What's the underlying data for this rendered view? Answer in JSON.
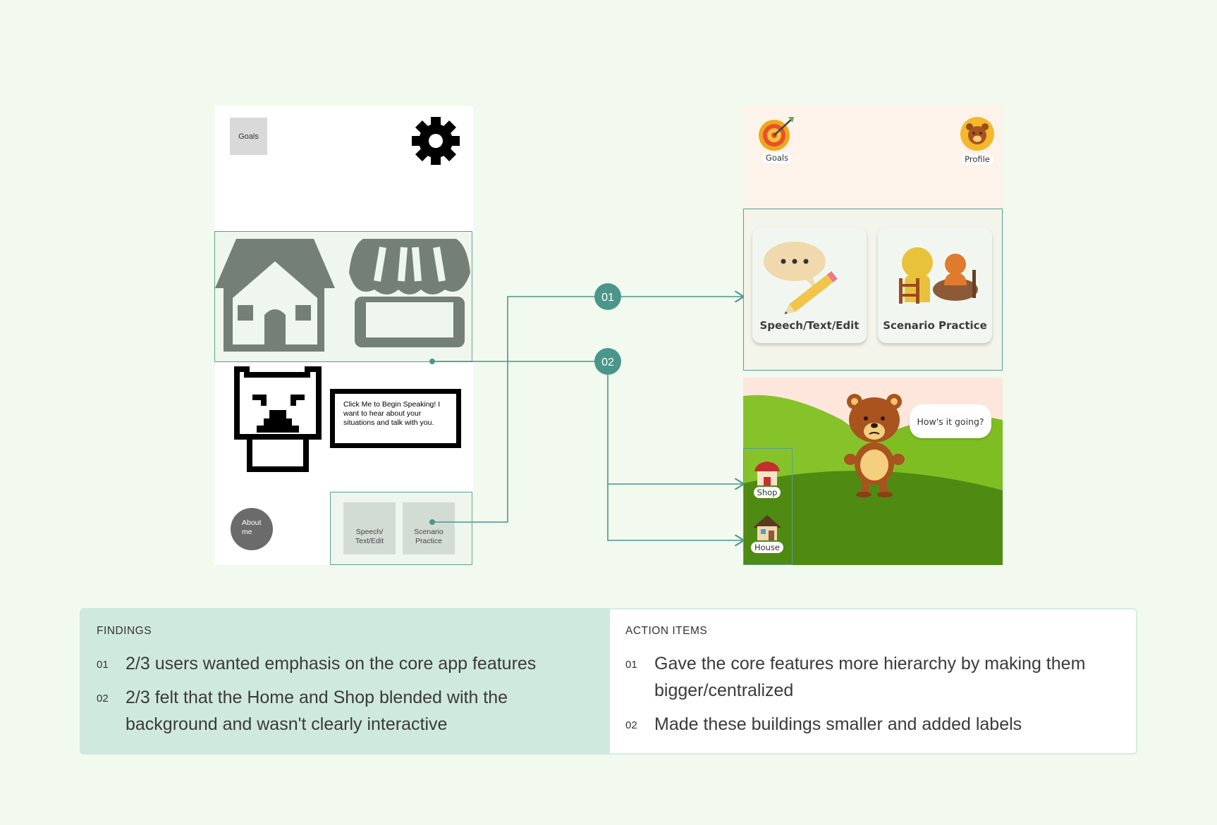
{
  "wireframe": {
    "goals_label": "Goals",
    "speech_bubble_text": "Click Me to Begin Speaking! I want to hear about your situations and talk with you.",
    "about_label": "About me",
    "tile_speech_label": "Speech/ Text/Edit",
    "tile_scenario_label": "Scenario Practice"
  },
  "markers": [
    "01",
    "02"
  ],
  "hifi": {
    "goals_label": "Goals",
    "profile_label": "Profile",
    "card_speech_label": "Speech/Text/Edit",
    "card_scenario_label": "Scenario Practice",
    "bubble_text": "How's it going?",
    "shop_label": "Shop",
    "house_label": "House"
  },
  "findings": {
    "heading": "FINDINGS",
    "items": [
      {
        "num": "01",
        "text": "2/3 users wanted emphasis on the core app features"
      },
      {
        "num": "02",
        "text": "2/3 felt that the Home and Shop blended with the background and wasn't clearly interactive"
      }
    ]
  },
  "actions": {
    "heading": "ACTION ITEMS",
    "items": [
      {
        "num": "01",
        "text": "Gave the core features more hierarchy by making them bigger/centralized"
      },
      {
        "num": "02",
        "text": "Made these buildings smaller and added labels"
      }
    ]
  },
  "colors": {
    "background": "#f2f9ee",
    "accent_teal": "#4a968a",
    "findings_bg": "#cfe9df",
    "wireframe_grey": "#747f76"
  }
}
